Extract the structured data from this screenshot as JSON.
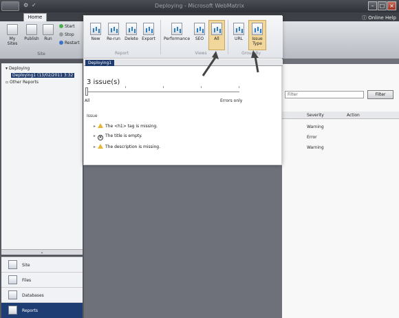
{
  "window": {
    "title": "Deploying - Microsoft WebMatrix",
    "help_label": "Online Help",
    "minimize": "–",
    "maximize": "□",
    "close": "×"
  },
  "ribbon": {
    "tab_home": "Home",
    "site_group": {
      "label": "Site",
      "my_sites": "My Sites",
      "publish": "Publish",
      "run": "Run",
      "start": "Start",
      "stop": "Stop",
      "restart": "Restart"
    }
  },
  "tree": {
    "root": "Deploying",
    "child": "Deploying1 (13/02/2011 3:32",
    "other": "Other Reports"
  },
  "workspaces": [
    {
      "label": "Site",
      "icon": "site-icon"
    },
    {
      "label": "Files",
      "icon": "files-icon"
    },
    {
      "label": "Databases",
      "icon": "databases-icon"
    },
    {
      "label": "Reports",
      "icon": "reports-icon",
      "active": true
    }
  ],
  "main": {
    "filter_placeholder": "Filter",
    "filter_button": "Filter",
    "columns": {
      "severity": "Severity",
      "action": "Action"
    },
    "severities": [
      "Warning",
      "Error",
      "Warning"
    ]
  },
  "overlay": {
    "report_group_label": "Report",
    "views_group_label": "Views",
    "groupby_group_label": "Group By",
    "report_buttons": [
      "New",
      "Re-run",
      "Delete",
      "Export"
    ],
    "view_buttons": [
      "Performance",
      "SEO",
      "All"
    ],
    "groupby_buttons": [
      "URL",
      "Issue Type"
    ],
    "doc_tab": "Deploying1",
    "issue_count_text": "3 issue(s)",
    "slider_left_label": "All",
    "slider_right_label": "Errors only",
    "issue_column": "Issue",
    "issues": [
      {
        "text": "The <h1> tag is missing.",
        "type": "warning"
      },
      {
        "text": "The title is empty.",
        "type": "error"
      },
      {
        "text": "The description is missing.",
        "type": "warning"
      }
    ]
  }
}
